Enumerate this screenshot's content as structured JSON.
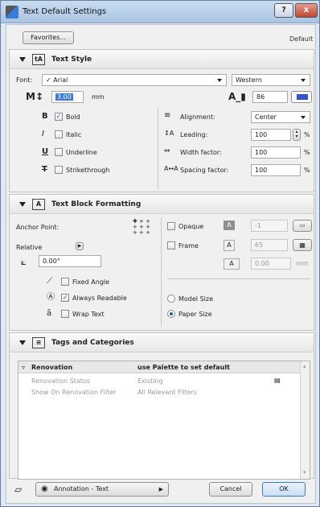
{
  "window": {
    "title": "Text Default Settings",
    "help_label": "?",
    "close_label": "x"
  },
  "toolbar": {
    "favorites_label": "Favorites...",
    "default_label": "Default"
  },
  "text_style": {
    "title": "Text Style",
    "font_label": "Font:",
    "font_value": "✓ Arial",
    "script_value": "Western",
    "size_value": "3.00",
    "size_unit": "mm",
    "pen_value": "86",
    "bold_label": "Bold",
    "bold_checked": true,
    "italic_label": "Italic",
    "italic_checked": false,
    "underline_label": "Underline",
    "underline_checked": false,
    "strike_label": "Strikethrough",
    "strike_checked": false,
    "alignment_label": "Alignment:",
    "alignment_value": "Center",
    "leading_label": "Leading:",
    "leading_value": "100",
    "leading_unit": "%",
    "width_label": "Width factor:",
    "width_value": "100",
    "width_unit": "%",
    "spacing_label": "Spacing factor:",
    "spacing_value": "100",
    "spacing_unit": "%"
  },
  "text_block": {
    "title": "Text Block Formatting",
    "anchor_label": "Anchor Point:",
    "relative_label": "Relative",
    "angle_value": "0.00°",
    "fixed_angle_label": "Fixed Angle",
    "always_readable_label": "Always Readable",
    "wrap_text_label": "Wrap Text",
    "opaque_label": "Opaque",
    "opaque_value": "-1",
    "frame_label": "Frame",
    "frame_value": "65",
    "frame_offset_value": "0.00",
    "frame_offset_unit": "mm",
    "model_size_label": "Model Size",
    "paper_size_label": "Paper Size"
  },
  "tags": {
    "title": "Tags and Categories",
    "header_name": "Renovation",
    "header_value": "use Palette to set default",
    "rows": [
      {
        "name": "Renovation Status",
        "value": "Existing"
      },
      {
        "name": "Show On Renovation Filter",
        "value": "All Relevant Filters"
      }
    ]
  },
  "footer": {
    "layer_value": "Annotation - Text",
    "cancel_label": "Cancel",
    "ok_label": "OK"
  }
}
